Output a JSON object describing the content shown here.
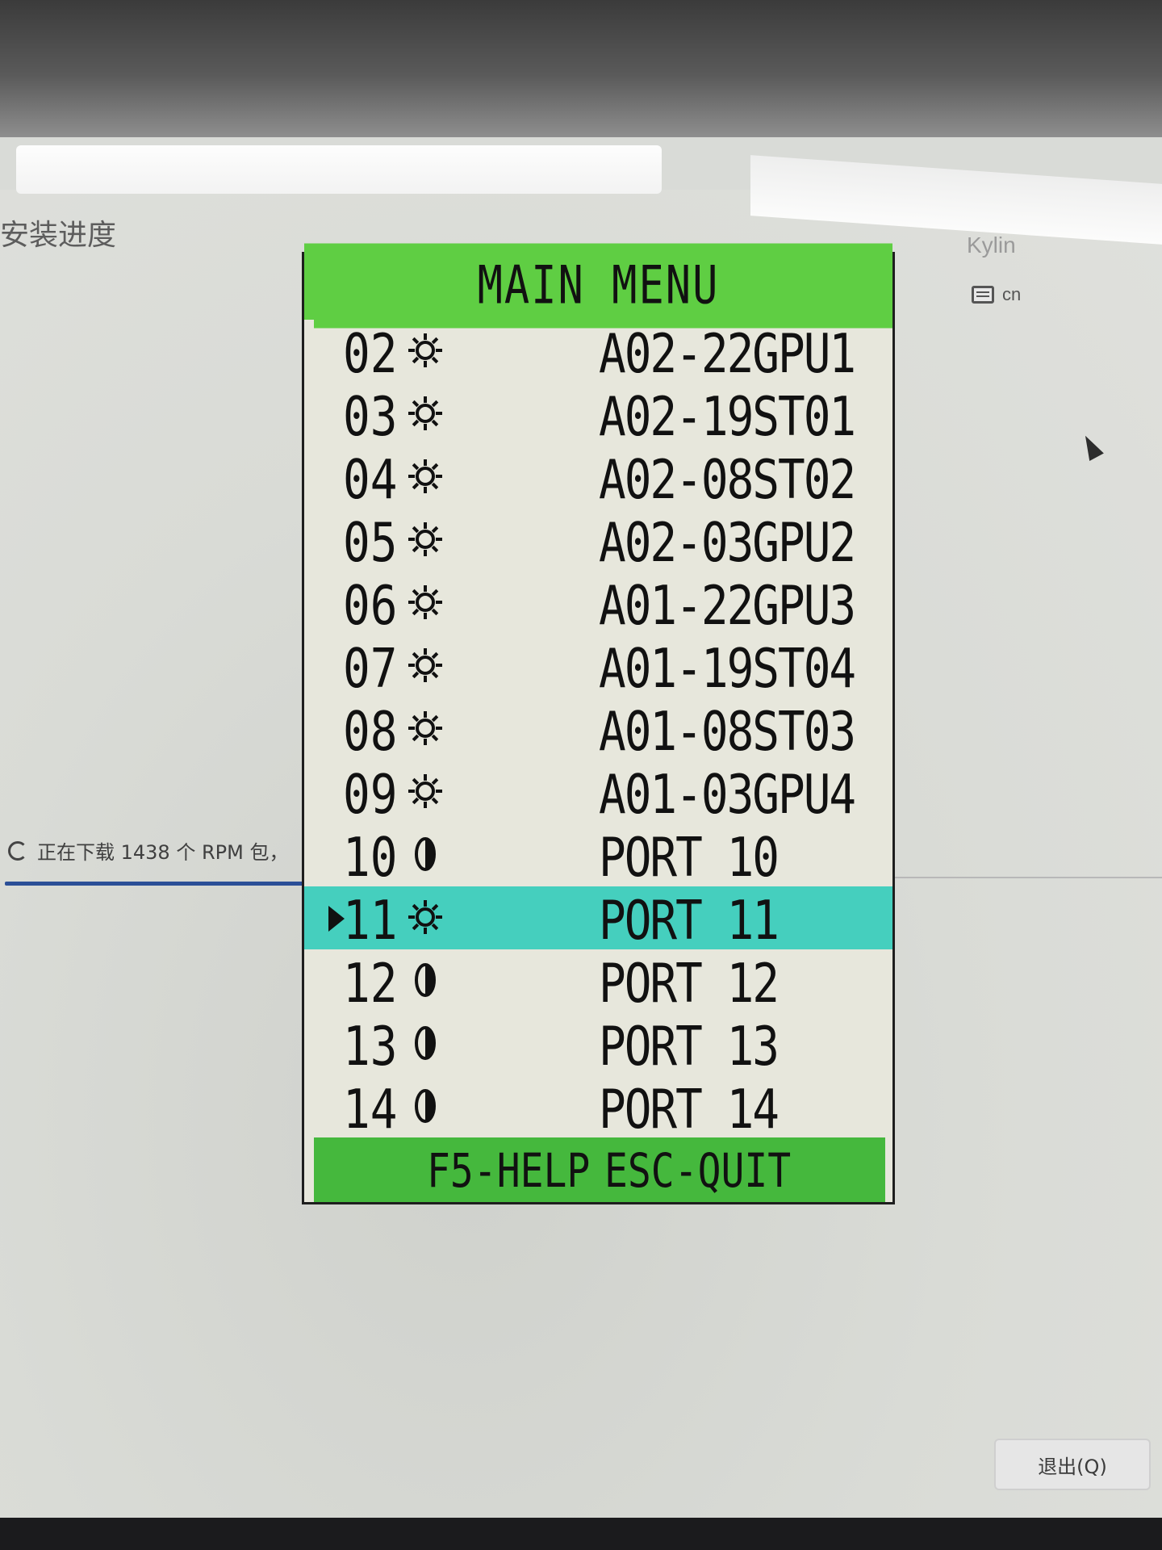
{
  "installer": {
    "title": "安装进度",
    "brand": "Kylin",
    "keyboard_layout": "cn",
    "progress_text": "正在下载 1438 个 RPM 包，",
    "quit_button": "退出(Q)"
  },
  "kvm_menu": {
    "title": "MAIN MENU",
    "rows": [
      {
        "num": "02",
        "icon": "sun-icon",
        "name": "A02-22GPU1",
        "selected": false
      },
      {
        "num": "03",
        "icon": "sun-icon",
        "name": "A02-19ST01",
        "selected": false
      },
      {
        "num": "04",
        "icon": "sun-icon",
        "name": "A02-08ST02",
        "selected": false
      },
      {
        "num": "05",
        "icon": "sun-icon",
        "name": "A02-03GPU2",
        "selected": false
      },
      {
        "num": "06",
        "icon": "sun-icon",
        "name": "A01-22GPU3",
        "selected": false
      },
      {
        "num": "07",
        "icon": "sun-icon",
        "name": "A01-19ST04",
        "selected": false
      },
      {
        "num": "08",
        "icon": "sun-icon",
        "name": "A01-08ST03",
        "selected": false
      },
      {
        "num": "09",
        "icon": "sun-icon",
        "name": "A01-03GPU4",
        "selected": false
      },
      {
        "num": "10",
        "icon": "moon-icon",
        "name": "PORT 10",
        "selected": false
      },
      {
        "num": "11",
        "icon": "sun-icon",
        "name": "PORT 11",
        "selected": true
      },
      {
        "num": "12",
        "icon": "moon-icon",
        "name": "PORT 12",
        "selected": false
      },
      {
        "num": "13",
        "icon": "moon-icon",
        "name": "PORT 13",
        "selected": false
      },
      {
        "num": "14",
        "icon": "moon-icon",
        "name": "PORT 14",
        "selected": false
      }
    ],
    "footer": {
      "help": "F5-HELP",
      "quit": "ESC-QUIT"
    }
  },
  "colors": {
    "header_green": "#5fce43",
    "footer_green": "#45b83d",
    "selected_teal": "#45cfbe",
    "menu_bg": "#e7e7dc"
  }
}
